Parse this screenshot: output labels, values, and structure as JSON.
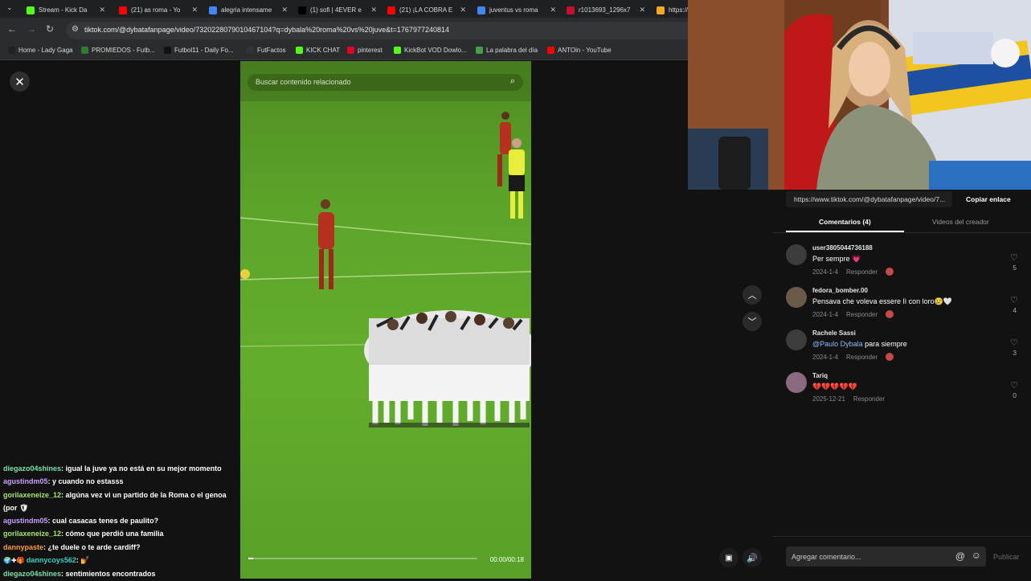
{
  "browser": {
    "tabs": [
      {
        "label": "Stream - Kick Da",
        "color": "#53fc18",
        "icon": "kick-icon"
      },
      {
        "label": "(21) as roma - Yo",
        "color": "#ff0000",
        "icon": "youtube-icon"
      },
      {
        "label": "alegria intensame",
        "color": "#4285f4",
        "icon": "google-icon"
      },
      {
        "label": "(1) sofi | 4EVER e",
        "color": "#000000",
        "icon": "x-icon"
      },
      {
        "label": "(21) ¡LA COBRA E",
        "color": "#ff0000",
        "icon": "youtube-icon"
      },
      {
        "label": "juventus vs roma",
        "color": "#4285f4",
        "icon": "google-icon"
      },
      {
        "label": "r1013693_1296x7",
        "color": "#c8102e",
        "icon": "image-icon"
      },
      {
        "label": "https://",
        "color": "#f5a623",
        "icon": "web-icon"
      }
    ],
    "url": "tiktok.com/@dybatafanpage/video/7320228079010467104?q=dybala%20roma%20vs%20juve&t=1767977240814",
    "bookmarks": [
      {
        "label": "Home - Lady Gaga",
        "color": "#222222"
      },
      {
        "label": "PROMIEDOS - Futb...",
        "color": "#2e7d32"
      },
      {
        "label": "Futbol11 - Daily Fo...",
        "color": "#111111"
      },
      {
        "label": "FutFactos",
        "color": "#333333"
      },
      {
        "label": "KICK CHAT",
        "color": "#53fc18"
      },
      {
        "label": "pinterest",
        "color": "#e60023"
      },
      {
        "label": "KickBot VOD Dowlo...",
        "color": "#53fc18"
      },
      {
        "label": "La palabra del día",
        "color": "#43a047"
      },
      {
        "label": "ANTOin - YouTube",
        "color": "#ff0000"
      }
    ]
  },
  "video": {
    "search_placeholder": "Buscar contenido relacionado",
    "time": "00:00/00:18",
    "progress": 0.02
  },
  "sidebar": {
    "link": "https://www.tiktok.com/@dybatafanpage/video/7...",
    "copy_label": "Copiar enlace",
    "tabs": [
      "Comentarios (4)",
      "Videos del creador"
    ],
    "comments": [
      {
        "user": "user3805044736188",
        "text": "Per sempre 💗",
        "date": "2024-1-4",
        "reply": "Responder",
        "likes": "5"
      },
      {
        "user": "fedora_bomber.00",
        "text": "Pensava che voleva essere lì con loro😢🤍",
        "date": "2024-1-4",
        "reply": "Responder",
        "likes": "4"
      },
      {
        "user": "Rachele Sassi",
        "mention": "@Paulo Dybala",
        "text": " para siempre",
        "date": "2024-1-4",
        "reply": "Responder",
        "likes": "3"
      },
      {
        "user": "Tariq",
        "text": "💔💔💔💔💔",
        "date": "2025-12-21",
        "reply": "Responder",
        "likes": "0"
      }
    ],
    "comment_placeholder": "Agregar comentario...",
    "publish_label": "Publicar"
  },
  "chat": [
    {
      "user": "diegazo04shines",
      "color": "#7ee0a8",
      "text": ": igual la juve ya no está en su mejor momento"
    },
    {
      "user": "agustindm05",
      "color": "#c9a0ff",
      "text": ": y cuando no estasss"
    },
    {
      "user": "gorilaxeneize_12",
      "color": "#a6e36e",
      "text": ": algúna vez vi un partido de la Roma o el genoa"
    },
    {
      "user": "",
      "color": "#ffffff",
      "text": "(por 🛡"
    },
    {
      "user": "agustindm05",
      "color": "#c9a0ff",
      "text": ": cual casacas tenes de paulito?"
    },
    {
      "user": "gorilaxeneize_12",
      "color": "#a6e36e",
      "text": ": cómo que perdió una familia"
    },
    {
      "user": "dannypaste",
      "color": "#ff9a3c",
      "text": ": ¿te duele o te arde cardiff?"
    },
    {
      "user": "dannycoys562",
      "color": "#39d0c8",
      "text": ": 💅"
    },
    {
      "user": "diegazo04shines",
      "color": "#7ee0a8",
      "text": ": sentimientos encontrados"
    }
  ]
}
